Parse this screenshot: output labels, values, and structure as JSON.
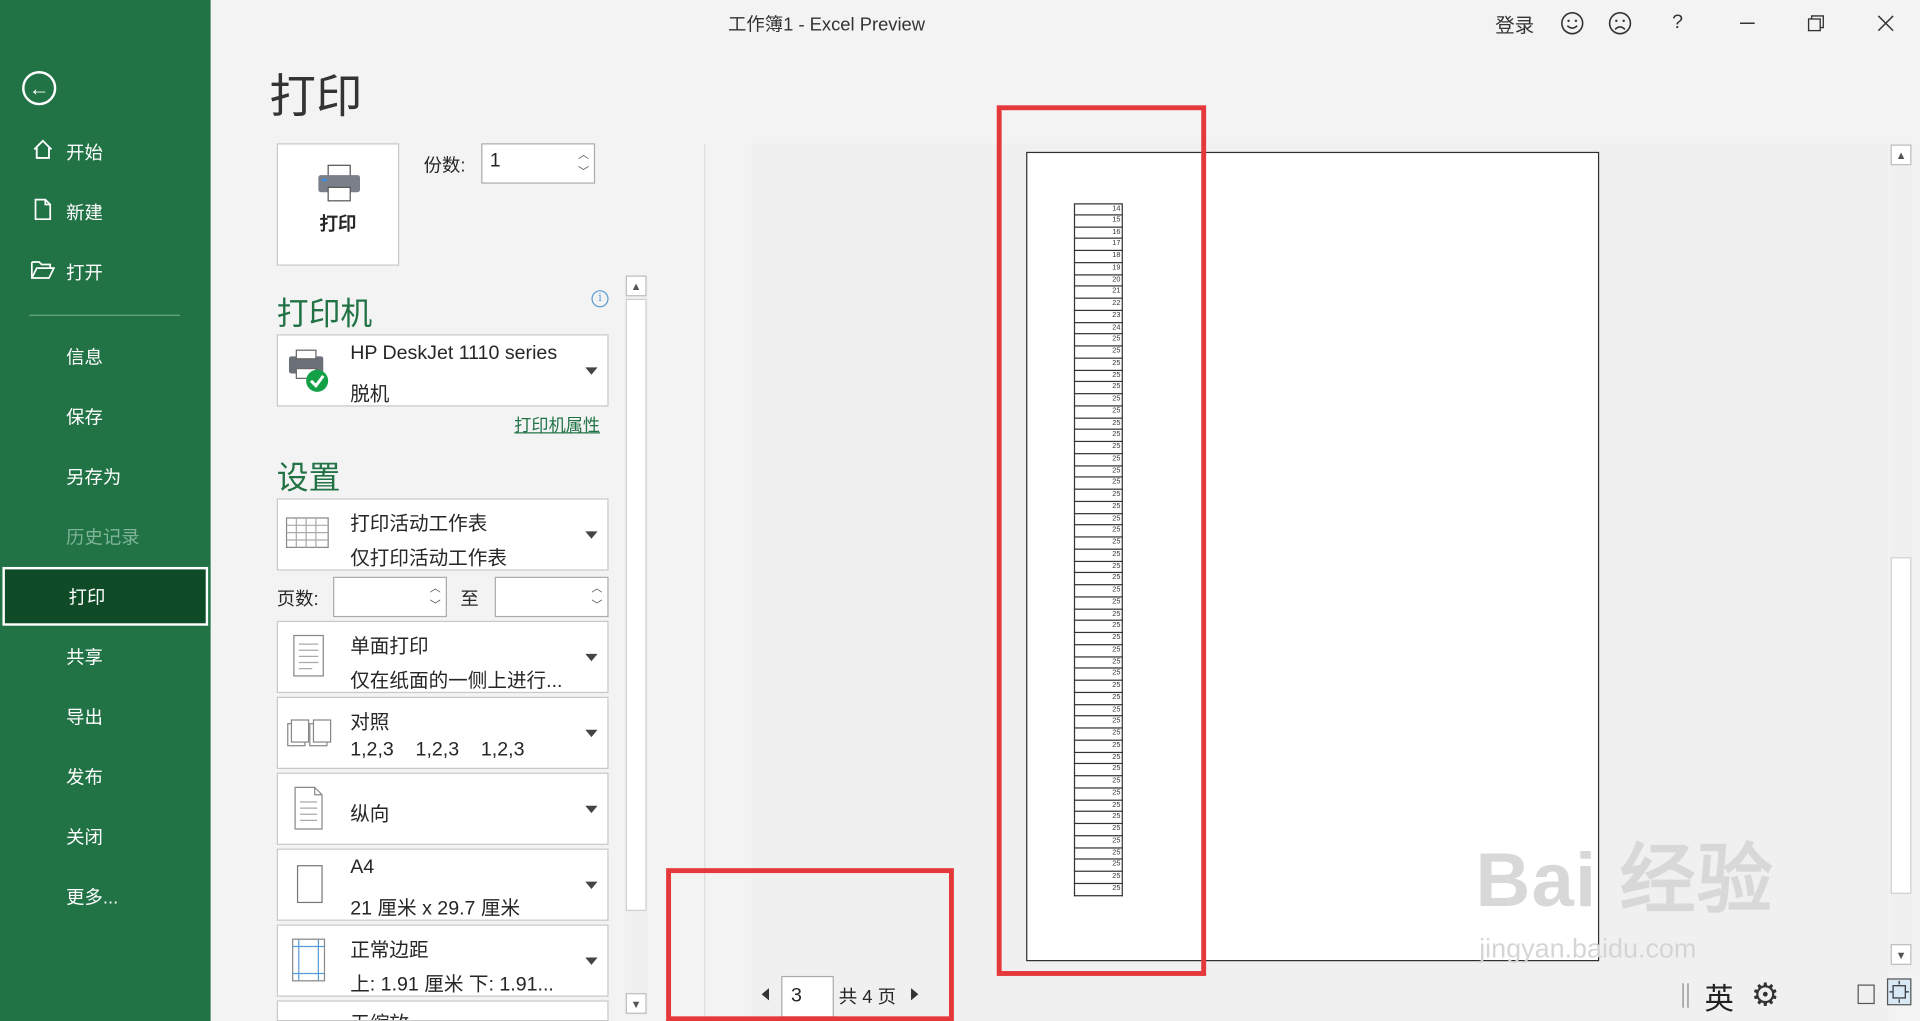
{
  "window": {
    "title": "工作簿1  -  Excel Preview",
    "signin_label": "登录",
    "help_label": "?"
  },
  "nav": {
    "items": [
      {
        "label": "开始"
      },
      {
        "label": "新建"
      },
      {
        "label": "打开"
      },
      {
        "label": "信息"
      },
      {
        "label": "保存"
      },
      {
        "label": "另存为"
      },
      {
        "label": "历史记录"
      },
      {
        "label": "打印"
      },
      {
        "label": "共享"
      },
      {
        "label": "导出"
      },
      {
        "label": "发布"
      },
      {
        "label": "关闭"
      },
      {
        "label": "更多..."
      }
    ],
    "active": "打印",
    "disabled": "历史记录"
  },
  "print": {
    "heading": "打印",
    "print_button_label": "打印",
    "copies_label": "份数:",
    "copies_value": "1",
    "printer_section": "打印机",
    "printer_name": "HP DeskJet 1110 series",
    "printer_status": "脱机",
    "printer_properties_link": "打印机属性",
    "settings_section": "设置",
    "what_to_print": {
      "line1": "打印活动工作表",
      "line2": "仅打印活动工作表"
    },
    "pages_label": "页数:",
    "pages_from": "",
    "pages_to_label": "至",
    "pages_to": "",
    "sides": {
      "line1": "单面打印",
      "line2": "仅在纸面的一侧上进行..."
    },
    "collation": {
      "line1": "对照",
      "line2": "1,2,3    1,2,3    1,2,3"
    },
    "orientation": {
      "line1": "纵向"
    },
    "paper": {
      "line1": "A4",
      "line2": "21 厘米 x 29.7 厘米"
    },
    "margins": {
      "line1": "正常边距",
      "line2": "上: 1.91 厘米 下: 1.91..."
    },
    "scaling": {
      "line1": "无缩放"
    }
  },
  "preview": {
    "current_page": "3",
    "total_pages_label": "共 4 页",
    "row_numbers": [
      "14",
      "15",
      "16",
      "17",
      "18",
      "19",
      "20",
      "21",
      "22",
      "23",
      "24",
      "25",
      "25",
      "25",
      "25",
      "25",
      "25",
      "25",
      "25",
      "25",
      "25",
      "25",
      "25",
      "25",
      "25",
      "25",
      "25",
      "25",
      "25",
      "25",
      "25",
      "25",
      "25",
      "25",
      "25",
      "25",
      "25",
      "25",
      "25",
      "25",
      "25",
      "25",
      "25",
      "25",
      "25",
      "25",
      "25",
      "25",
      "25",
      "25",
      "25",
      "25",
      "25",
      "25",
      "25",
      "25",
      "25",
      "25"
    ]
  },
  "statusbar": {
    "ime_label": "英"
  },
  "watermark": {
    "brand": "Bai 经验",
    "url": "jingyan.baidu.com"
  }
}
